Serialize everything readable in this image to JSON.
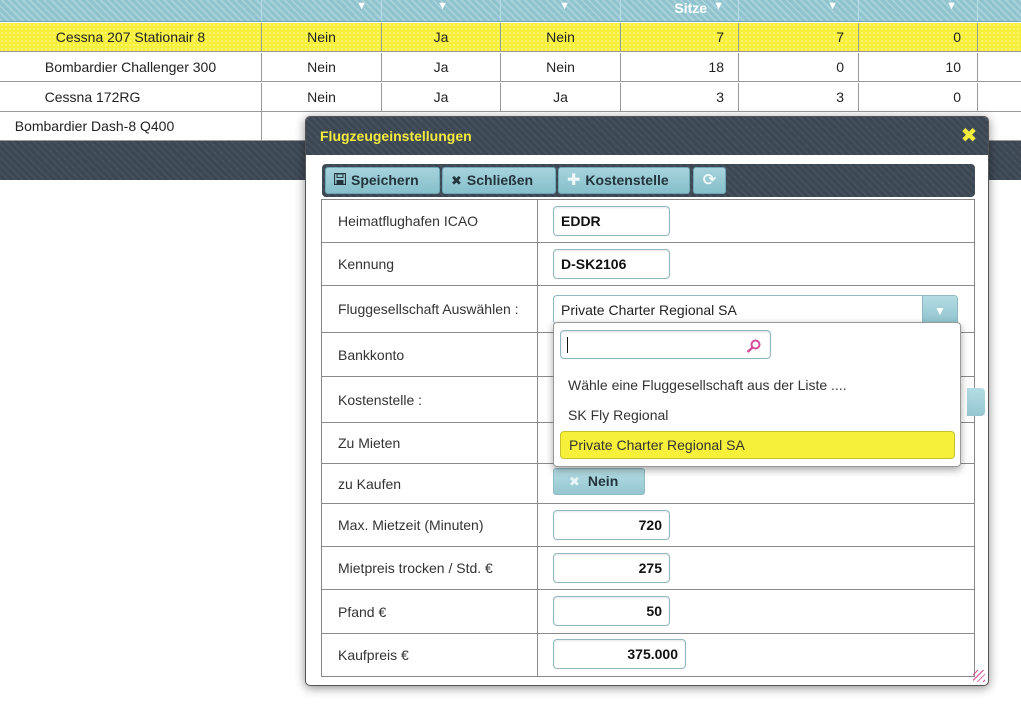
{
  "background_table": {
    "header": {
      "visible_label": "Sitze",
      "sort_icons": [
        "▼",
        "▼",
        "▼",
        "▼",
        "▼"
      ]
    },
    "rows": [
      {
        "name": "Cessna 207 Stationair 8",
        "c1": "Nein",
        "c2": "Ja",
        "c3": "Nein",
        "n1": "7",
        "n2": "7",
        "n3": "0"
      },
      {
        "name": "Bombardier Challenger 300",
        "c1": "Nein",
        "c2": "Ja",
        "c3": "Nein",
        "n1": "18",
        "n2": "0",
        "n3": "10"
      },
      {
        "name": "Cessna 172RG",
        "c1": "Nein",
        "c2": "Ja",
        "c3": "Ja",
        "n1": "3",
        "n2": "3",
        "n3": "0"
      },
      {
        "name": "Bombardier Dash-8 Q400"
      }
    ]
  },
  "dialog": {
    "title": "Flugzeugeinstellungen",
    "close_glyph": "✖",
    "toolbar": {
      "save_label": "Speichern",
      "close_label": "Schließen",
      "cost_center_label": "Kostenstelle",
      "save_icon": "save-icon",
      "close_icon": "close-icon",
      "plus_icon": "plus-icon",
      "refresh_icon": "refresh-icon"
    },
    "fields": {
      "home_airport_label": "Heimatflughafen ICAO",
      "home_airport_value": "EDDR",
      "registration_label": "Kennung",
      "registration_value": "D-SK2106",
      "airline_label": "Fluggesellschaft Auswählen :",
      "airline_value": "Private Charter Regional SA",
      "bank_account_label": "Bankkonto",
      "cost_center_label": "Kostenstelle :",
      "for_rent_label": "Zu Mieten",
      "for_sale_label": "zu Kaufen",
      "for_sale_value": "Nein",
      "max_rent_label": "Max. Mietzeit (Minuten)",
      "max_rent_value": "720",
      "rent_price_label": "Mietpreis trocken / Std. €",
      "rent_price_value": "275",
      "deposit_label": "Pfand €",
      "deposit_value": "50",
      "purchase_price_label": "Kaufpreis €",
      "purchase_price_value": "375.000"
    },
    "airline_dropdown": {
      "search_value": "",
      "options": [
        "Wähle eine Fluggesellschaft aus der Liste ....",
        "SK Fly Regional",
        "Private Charter Regional SA"
      ],
      "selected_index": 2
    }
  },
  "colors": {
    "selected_yellow": "#f6f03a",
    "dark_bar": "#3c4754",
    "accent_teal": "#8fc4cf",
    "title_yellow": "#f4ec3c"
  }
}
